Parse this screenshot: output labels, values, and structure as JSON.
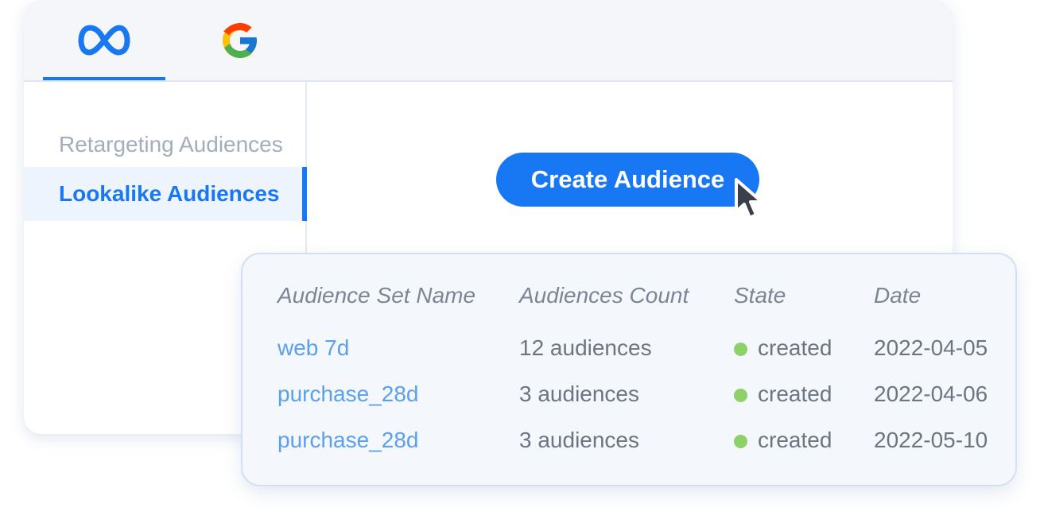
{
  "colors": {
    "accent": "#1877f2",
    "status_created": "#8fd169",
    "link": "#5aa0ef"
  },
  "tabs": [
    {
      "icon": "meta-logo-icon",
      "active": true
    },
    {
      "icon": "google-logo-icon",
      "active": false
    }
  ],
  "sidebar": {
    "items": [
      {
        "label": "Retargeting Audiences",
        "active": false
      },
      {
        "label": "Lookalike Audiences",
        "active": true
      }
    ]
  },
  "main": {
    "create_button_label": "Create Audience"
  },
  "table": {
    "columns": [
      "Audience Set Name",
      "Audiences Count",
      "State",
      "Date"
    ],
    "rows": [
      {
        "name": "web 7d",
        "count": "12 audiences",
        "state": "created",
        "date": "2022-04-05"
      },
      {
        "name": "purchase_28d",
        "count": "3 audiences",
        "state": "created",
        "date": "2022-04-06"
      },
      {
        "name": "purchase_28d",
        "count": "3 audiences",
        "state": "created",
        "date": "2022-05-10"
      }
    ]
  }
}
